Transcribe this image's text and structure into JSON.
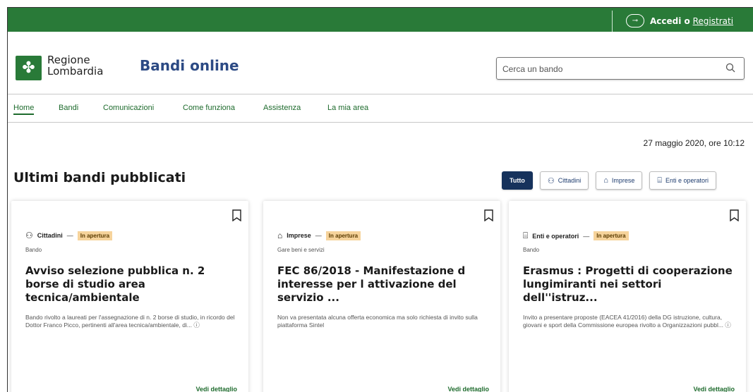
{
  "topbar": {
    "login_label": "Accedi o",
    "register_label": "Registrati",
    "key_icon": "key-icon"
  },
  "header": {
    "logo_line1": "Regione",
    "logo_line2": "Lombardia",
    "site_title": "Bandi online",
    "search_placeholder": "Cerca un bando"
  },
  "nav": {
    "items": [
      "Home",
      "Bandi",
      "Comunicazioni",
      "Come funziona",
      "Assistenza",
      "La mia area"
    ],
    "active": "Home"
  },
  "date": "27 maggio 2020, ore 10:12",
  "section_title": "Ultimi bandi pubblicati",
  "filters": [
    "Tutto",
    "Cittadini",
    "Imprese",
    "Enti e operatori"
  ],
  "cards": [
    {
      "category": "Cittadini",
      "dash": "—",
      "status": "In apertura",
      "subtype": "Bando",
      "title": "Avviso selezione pubblica n. 2 borse di studio area tecnica/ambientale",
      "description": "Bando rivolto a laureati per l'assegnazione di n. 2 borse di studio, in ricordo del Dottor Franco Picco, pertinenti all'area tecnica/ambientale, di... ⓘ",
      "more": "Vedi dettaglio"
    },
    {
      "category": "Imprese",
      "dash": "—",
      "status": "In apertura",
      "subtype": "Gare beni e servizi",
      "title": "FEC 86/2018 - Manifestazione d interesse per l attivazione del servizio ...",
      "description": "Non va presentata alcuna offerta economica ma solo richiesta di invito sulla piattaforma Sintel",
      "more": "Vedi dettaglio"
    },
    {
      "category": "Enti e operatori",
      "dash": "—",
      "status": "In apertura",
      "subtype": "Bando",
      "title": "Erasmus : Progetti di cooperazione lungimiranti nei settori dell''istruz...",
      "description": "Invito a presentare proposte (EACEA 41/2016) della DG istruzione, cultura, giovani e sport della Commissione europea rivolto a Organizzazioni pubbl... ⓘ",
      "more": "Vedi dettaglio"
    }
  ],
  "colors": {
    "brand_green": "#297a38",
    "title_blue": "#2c4a84",
    "badge": "#f6d39b",
    "filter_active": "#16325c"
  }
}
